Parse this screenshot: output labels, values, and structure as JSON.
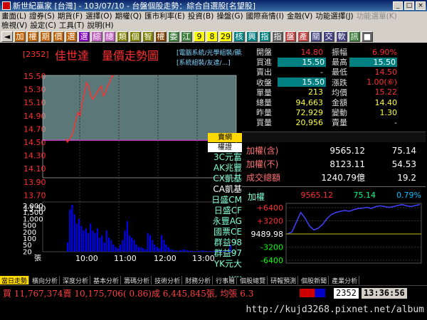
{
  "window": {
    "title": "新世紀贏家 [台灣] - 103/07/10 - 台盤個股走勢：綜合自選股[名望股]",
    "min": "_",
    "max": "□",
    "close": "×"
  },
  "menu": {
    "row1": [
      {
        "label": "畫面(L)"
      },
      {
        "label": "證券(S)"
      },
      {
        "label": "期貨(F)"
      },
      {
        "label": "選擇(O)"
      },
      {
        "label": "期權(Q)"
      },
      {
        "label": "匯市利率(E)"
      },
      {
        "label": "投資(B)"
      },
      {
        "label": "操盤(G)"
      },
      {
        "label": "國際商情(I)"
      },
      {
        "label": "金融(V)"
      },
      {
        "label": "功能選擇(J)"
      },
      {
        "label": "功能選單(K)",
        "disabled": true
      }
    ],
    "row2": [
      {
        "label": "檢視(V)"
      },
      {
        "label": "設定(C)"
      },
      {
        "label": "工具(T)"
      },
      {
        "label": "說明(H)"
      }
    ]
  },
  "toolbar": [
    {
      "label": "◄",
      "color": "#000",
      "bg": "#d4d0c8"
    },
    {
      "label": "加",
      "color": "#fff",
      "bg": "#c06000"
    },
    {
      "label": "權",
      "color": "#fff",
      "bg": "#c06000"
    },
    {
      "label": "期",
      "color": "#fff",
      "bg": "#c06000"
    },
    {
      "label": "價",
      "color": "#fff",
      "bg": "#c06000"
    },
    {
      "label": "選",
      "color": "#fff",
      "bg": "#c06000"
    },
    {
      "label": "選",
      "color": "#fff",
      "bg": "#8000c0"
    },
    {
      "label": "綜",
      "color": "#fff",
      "bg": "#c060c0"
    },
    {
      "label": "總",
      "color": "#fff",
      "bg": "#c060c0"
    },
    {
      "label": "類",
      "color": "#fff",
      "bg": "#808000"
    },
    {
      "label": "個",
      "color": "#fff",
      "bg": "#808000"
    },
    {
      "label": "智",
      "color": "#fff",
      "bg": "#808000"
    },
    {
      "label": "權",
      "color": "#fff",
      "bg": "#804000"
    },
    {
      "label": "委",
      "color": "#fff",
      "bg": "#408040"
    },
    {
      "label": "江",
      "color": "#fff",
      "bg": "#408040"
    },
    {
      "label": "9",
      "color": "#000",
      "bg": "#ffff00"
    },
    {
      "label": "8",
      "color": "#000",
      "bg": "#ffff00"
    },
    {
      "label": "29",
      "color": "#000",
      "bg": "#ffff00"
    },
    {
      "label": "核",
      "color": "#fff",
      "bg": "#008080"
    },
    {
      "label": "興",
      "color": "#fff",
      "bg": "#008080"
    },
    {
      "label": "指",
      "color": "#fff",
      "bg": "#008080"
    },
    {
      "label": "指",
      "color": "#fff",
      "bg": "#606060"
    },
    {
      "label": "盤",
      "color": "#fff",
      "bg": "#c04040"
    },
    {
      "label": "產",
      "color": "#fff",
      "bg": "#c04040"
    },
    {
      "label": "關",
      "color": "#fff",
      "bg": "#404080"
    },
    {
      "label": "交",
      "color": "#fff",
      "bg": "#404080"
    },
    {
      "label": "軟",
      "color": "#fff",
      "bg": "#404080"
    },
    {
      "label": "訊",
      "color": "#fff",
      "bg": "#408040"
    },
    {
      "label": "■",
      "color": "#fff",
      "bg": "#606060"
    }
  ],
  "stock": {
    "code": "[2352]",
    "name": "佳世達",
    "chart_title": "量價走勢圖",
    "tag1": "[電腦系統/光學組裝/顯示器]",
    "tag2": "[系統組裝/友達/...]"
  },
  "colors": {
    "up": "#ff3030",
    "down": "#00ff00",
    "flat": "#ffffff",
    "price_line": "#ff3030",
    "bar_area": "#a8d8d8",
    "volume": "#0000ff",
    "ref_line": "#ff40ff"
  },
  "axes": {
    "price_ticks": [
      "15.50",
      "15.30",
      "15.10",
      "14.90",
      "14.70",
      "14.50",
      "14.30",
      "14.10",
      "13.90",
      "13.70",
      "13.50"
    ],
    "price_tick_colors": [
      "#ff3030",
      "#ff3030",
      "#ff3030",
      "#ff3030",
      "#ff3030",
      "#ff3030",
      "#ff3030",
      "#ff3030",
      "#ff3030",
      "#ff3030",
      "#ffffff"
    ],
    "volume_ticks": [
      "2,000",
      "1,500",
      "1,000",
      "500",
      "200",
      "100",
      "50",
      "20",
      "張"
    ],
    "time_ticks": [
      "10:00",
      "11:00",
      "12:00",
      "13:00"
    ]
  },
  "chart_data": {
    "type": "line",
    "price_series": [
      14.55,
      14.5,
      14.55,
      14.6,
      14.7,
      14.85,
      14.95,
      14.9,
      15.1,
      15.25,
      15.4,
      15.35,
      15.2,
      15.15,
      15.2,
      15.25,
      15.3,
      15.35,
      15.2,
      15.25,
      15.35,
      15.4,
      15.5,
      15.5
    ],
    "ref_price": 14.53,
    "volume_series": [
      400,
      1800,
      2000,
      1600,
      1200,
      1400,
      1100,
      900,
      1000,
      800,
      1200,
      900,
      800,
      1000,
      600,
      700,
      400,
      900,
      600,
      500,
      300,
      200,
      150,
      300,
      500,
      900,
      1300,
      700,
      600,
      500,
      300,
      200,
      200,
      150,
      100,
      800,
      700,
      500,
      300,
      200,
      150,
      700,
      500,
      300,
      200,
      100,
      80,
      60,
      40,
      60,
      80,
      100,
      70,
      50,
      40,
      30,
      30,
      40,
      50,
      60,
      40,
      30,
      20,
      30,
      50,
      40,
      30,
      20,
      30,
      40,
      30,
      300
    ],
    "ylim": [
      13.5,
      15.5
    ]
  },
  "quote": {
    "left": [
      {
        "label": "開盤",
        "value": "14.80",
        "color": "#ff3030"
      },
      {
        "label": "買進",
        "value": "15.50",
        "color": "#ff3030",
        "boxed": true
      },
      {
        "label": "賣出",
        "value": "-",
        "color": "#ddd"
      },
      {
        "label": "收盤",
        "value": "15.50",
        "color": "#ff3030",
        "boxed": true
      },
      {
        "label": "單量",
        "value": "213",
        "color": "#ffff40"
      },
      {
        "label": "總量",
        "value": "94,663",
        "color": "#ffff40"
      },
      {
        "label": "昨量",
        "value": "72,929",
        "color": "#ffff40"
      },
      {
        "label": "買量",
        "value": "20,956",
        "color": "#ffff40"
      }
    ],
    "right": [
      {
        "label": "振幅",
        "value": "6.90%",
        "color": "#ff3030"
      },
      {
        "label": "最高",
        "value": "15.50",
        "color": "#ff3030",
        "boxed": true
      },
      {
        "label": "最低",
        "value": "14.50",
        "color": "#ff3030"
      },
      {
        "label": "漲跌",
        "value": "1.00(⑥)",
        "color": "#ff3030"
      },
      {
        "label": "均價",
        "value": "15.22",
        "color": "#ff3030"
      },
      {
        "label": "金額",
        "value": "14.40",
        "color": "#ffff40"
      },
      {
        "label": "變動",
        "value": "1.30",
        "color": "#ffff40"
      },
      {
        "label": "賣量",
        "value": "-",
        "color": "#ddd"
      }
    ]
  },
  "brokers": {
    "header1": "賣網",
    "header2": "權證",
    "list": [
      "3C元富",
      "AK兆豐",
      "CX凱基",
      "CA凱基",
      "日盛CM",
      "日盛CF",
      "永豐AG",
      "國票CE",
      "群益98",
      "群益97",
      "YK元大",
      "....."
    ]
  },
  "index": {
    "rows": [
      {
        "name": "加權(含)",
        "a": "9565.12",
        "b": "75.14"
      },
      {
        "name": "加權(不)",
        "a": "8123.11",
        "b": "54.53"
      },
      {
        "name": "成交總額",
        "a": "1240.79億",
        "b": "19.2"
      }
    ],
    "mini": {
      "label": "加權",
      "value": "9565.12",
      "change": "75.14",
      "pct": "0.79%",
      "ticks": [
        "+6400",
        "+3200",
        "9489.98",
        "-3200",
        "-6400"
      ]
    },
    "mini_series": [
      9490,
      9495,
      9520,
      9545,
      9530,
      9510,
      9500,
      9505,
      9515,
      9530,
      9540,
      9545,
      9548,
      9550,
      9548,
      9552,
      9555,
      9556,
      9558,
      9555,
      9560,
      9562,
      9560,
      9558,
      9560,
      9563,
      9565,
      9562,
      9560,
      9563,
      9565
    ]
  },
  "tabs": [
    {
      "label": "當日走勢",
      "active": true
    },
    {
      "label": "橫向分析"
    },
    {
      "label": "深度分析"
    },
    {
      "label": "基本分析"
    },
    {
      "label": "籌碼分析"
    },
    {
      "label": "技術分析"
    },
    {
      "label": "財務分析"
    },
    {
      "label": "行事曆"
    },
    {
      "label": "個股總覽"
    },
    {
      "label": "研報預測"
    },
    {
      "label": "個股新聞"
    },
    {
      "label": "產業分析"
    }
  ],
  "status": {
    "text": "買 11,767,374賣 10,175,706( 0.86)成 6,445,845張, 均張 6.3",
    "code": "2352",
    "time": "13:36:56"
  },
  "footer": {
    "url": "http://kujd3268.pixnet.net/album"
  }
}
